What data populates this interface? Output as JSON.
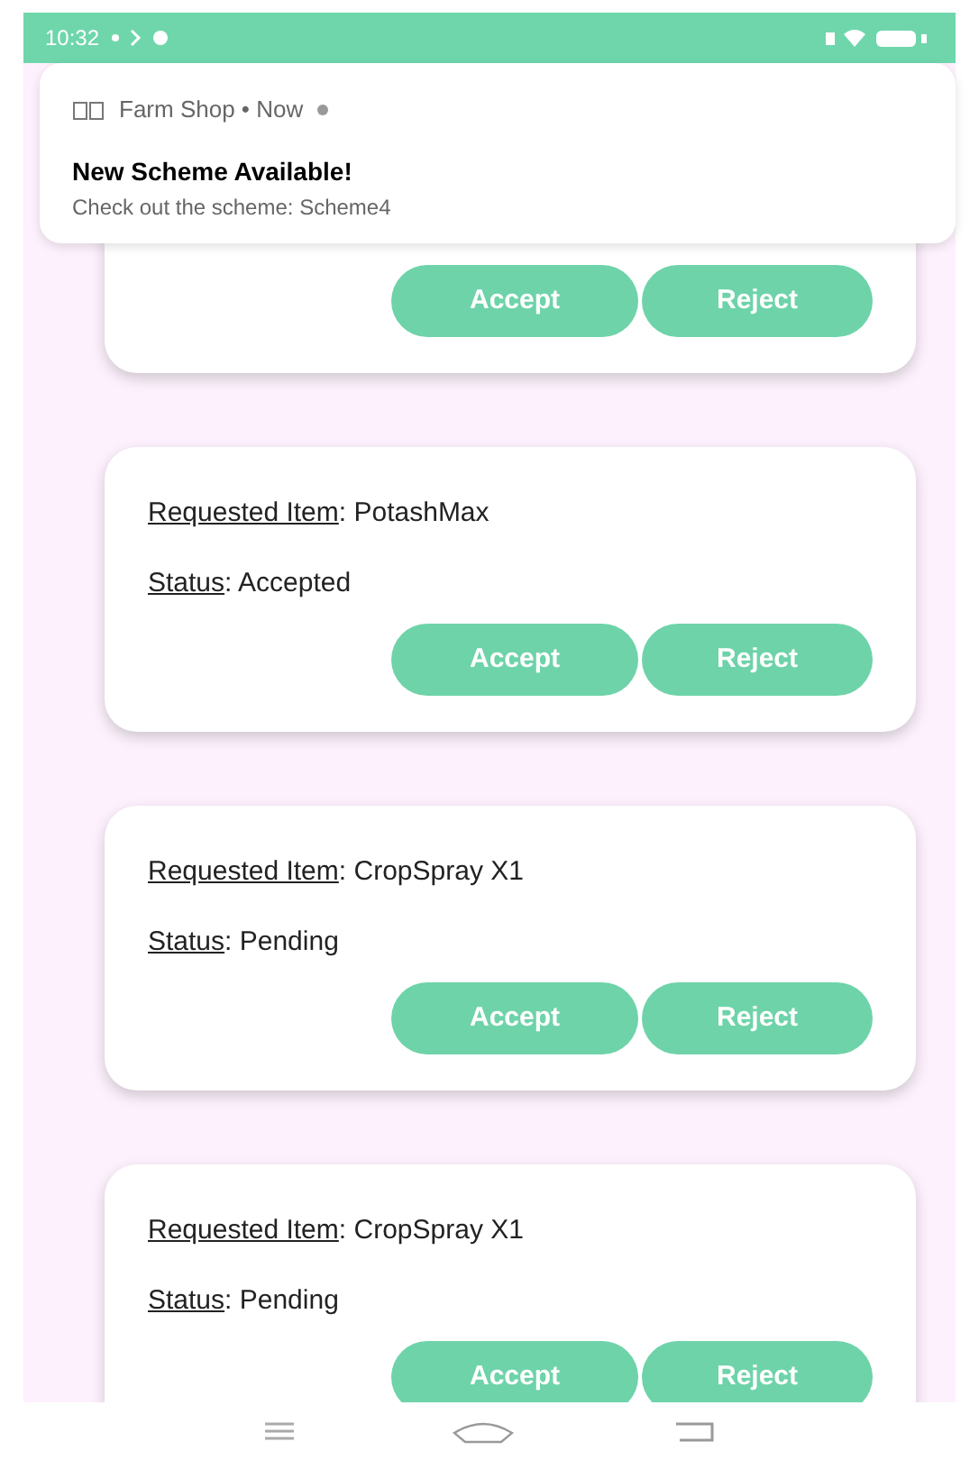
{
  "status_bar": {
    "time": "10:32"
  },
  "notification": {
    "source": "Farm Shop • Now",
    "title": "New Scheme Available!",
    "body": "Check out the scheme: Scheme4"
  },
  "requests": [
    {
      "buttons": [
        "Accept",
        "Reject"
      ]
    },
    {
      "item_label": "Requested Item",
      "item": ": PotashMax",
      "status_label": "Status",
      "status": ": Accepted",
      "buttons": [
        "Accept",
        "Reject"
      ]
    },
    {
      "item_label": "Requested Item",
      "item": ": CropSpray X1",
      "status_label": "Status",
      "status": ": Pending",
      "buttons": [
        "Accept",
        "Reject"
      ]
    },
    {
      "item_label": "Requested Item",
      "item": ": CropSpray X1",
      "status_label": "Status",
      "status": ": Pending",
      "buttons": [
        "Accept",
        "Reject"
      ]
    }
  ]
}
